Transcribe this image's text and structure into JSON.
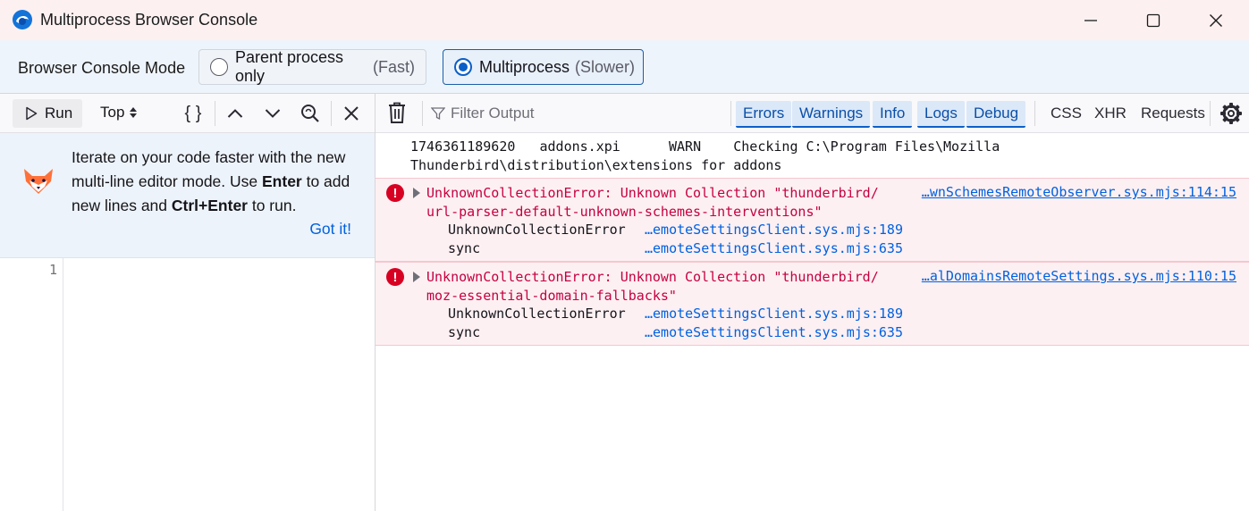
{
  "window": {
    "title": "Multiprocess Browser Console",
    "icons": {
      "app": "thunderbird-icon",
      "minimize": "minimize-icon",
      "maximize": "maximize-icon",
      "close": "close-icon"
    }
  },
  "mode_bar": {
    "label": "Browser Console Mode",
    "options": [
      {
        "label": "Parent process only",
        "sub": "(Fast)",
        "selected": false
      },
      {
        "label": "Multiprocess",
        "sub": "(Slower)",
        "selected": true
      }
    ]
  },
  "editor_toolbar": {
    "run_label": "Run",
    "context_label": "Top",
    "braces": "{ }",
    "icons": [
      "play-icon",
      "sort-icon",
      "pretty-print-icon",
      "history-up-icon",
      "history-down-icon",
      "reverse-search-icon",
      "close-editor-icon"
    ]
  },
  "tip": {
    "text_before_enter": "Iterate on your code faster with the new multi-line editor mode. Use ",
    "enter": "Enter",
    "text_middle": " to add new lines and ",
    "ctrl_enter": "Ctrl+Enter",
    "text_after": " to run.",
    "gotit": "Got it!"
  },
  "editor": {
    "line_number": "1"
  },
  "output_toolbar": {
    "filter_placeholder": "Filter Output",
    "filters_active": [
      "Errors",
      "Warnings",
      "Info",
      "Logs",
      "Debug"
    ],
    "filters_inactive": [
      "CSS",
      "XHR",
      "Requests"
    ],
    "icons": [
      "trash-icon",
      "filter-icon",
      "settings-gear-icon"
    ]
  },
  "messages": {
    "warn": {
      "line1": "1746361189620   addons.xpi      WARN    Checking C:\\Program Files\\Mozilla",
      "line2": "Thunderbird\\distribution\\extensions for addons"
    },
    "errors": [
      {
        "line1": "UnknownCollectionError: Unknown Collection \"thunderbird/",
        "line2": "url-parser-default-unknown-schemes-interventions\"",
        "source": "…wnSchemesRemoteObserver.sys.mjs:114:15",
        "stack": [
          {
            "fn": "UnknownCollectionError",
            "src": "…emoteSettingsClient.sys.mjs:189"
          },
          {
            "fn": "sync",
            "src": "…emoteSettingsClient.sys.mjs:635"
          }
        ]
      },
      {
        "line1": "UnknownCollectionError: Unknown Collection \"thunderbird/",
        "line2": "moz-essential-domain-fallbacks\"",
        "source": "…alDomainsRemoteSettings.sys.mjs:110:15",
        "stack": [
          {
            "fn": "UnknownCollectionError",
            "src": "…emoteSettingsClient.sys.mjs:189"
          },
          {
            "fn": "sync",
            "src": "…emoteSettingsClient.sys.mjs:635"
          }
        ]
      }
    ]
  },
  "colors": {
    "error_text": "#c50042",
    "link": "#0061e0",
    "error_bg": "#fdf0f2",
    "accent": "#0b5fc8"
  }
}
